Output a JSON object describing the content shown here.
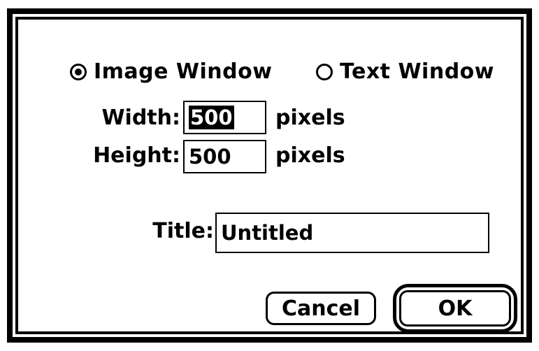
{
  "dialog": {
    "window_type": {
      "options": [
        {
          "label": "Image Window",
          "selected": true
        },
        {
          "label": "Text Window",
          "selected": false
        }
      ]
    },
    "dimensions": {
      "width_label": "Width:",
      "width_value": "500",
      "height_label": "Height:",
      "height_value": "500",
      "unit_label": "pixels"
    },
    "title_label": "Title:",
    "title_value": "Untitled",
    "buttons": {
      "cancel_label": "Cancel",
      "ok_label": "OK"
    }
  }
}
